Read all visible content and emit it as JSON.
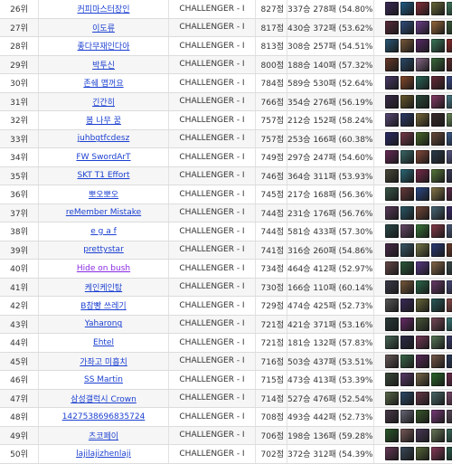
{
  "rankings": [
    {
      "rank": "26위",
      "name": "커피마스터장인",
      "tier": "CHALLENGER - I",
      "points": "827점",
      "record": "337승 278패 (54.80%)",
      "champs": [
        "#3b2a5a",
        "#1f5f8a",
        "#8a2f3a",
        "#6a6a3a",
        "#3f7a5f",
        "#c2a24a",
        "#2a3f7a",
        "#7a2a6a",
        "#3a6a8a",
        "#8a5a2a"
      ]
    },
    {
      "rank": "27위",
      "name": "이도류",
      "tier": "CHALLENGER - I",
      "points": "817점",
      "record": "430승 372패 (53.62%)",
      "champs": [
        "#5a2a3a",
        "#2f4f7f",
        "#6f3f8f",
        "#9a6a3a",
        "#3a5a3a",
        "#2a2a5a",
        "#7a3a2a",
        "#4a7a9a",
        "#9a4a6a",
        "#3a3a3a"
      ]
    },
    {
      "rank": "28위",
      "name": "좋다무재인다아",
      "tier": "CHALLENGER - I",
      "points": "813점",
      "record": "308승 257패 (54.51%)",
      "champs": [
        "#2a5a7a",
        "#7a5a3a",
        "#5a2a6a",
        "#3a7a5a",
        "#8a2a2a",
        "#4a4a8a",
        "#9a7a4a",
        "#2a3a5a",
        "#6a2a4a",
        "#5a6a2a"
      ]
    },
    {
      "rank": "29위",
      "name": "박투신",
      "tier": "CHALLENGER - I",
      "points": "800점",
      "record": "188승 140패 (57.32%)",
      "champs": [
        "#6a3a2a",
        "#2a4a6a",
        "#8a6a8a",
        "#3a6a3a",
        "#5a2a2a",
        "#2a6a8a",
        "#7a7a3a",
        "#4a2a6a",
        "#3a5a7a",
        "#8a3a5a"
      ]
    },
    {
      "rank": "30위",
      "name": "존쉐 맵꺼요",
      "tier": "CHALLENGER - I",
      "points": "784점",
      "record": "589승 530패 (52.64%)",
      "champs": [
        "#4a3a6a",
        "#8a4a2a",
        "#2a6a5a",
        "#6a2a3a",
        "#3a4a8a",
        "#9a8a5a",
        "#5a3a2a",
        "#2a5a4a",
        "#7a4a7a",
        "#4a6a9a"
      ]
    },
    {
      "rank": "31위",
      "name": "긴간히",
      "tier": "CHALLENGER - I",
      "points": "766점",
      "record": "354승 276패 (56.19%)",
      "champs": [
        "#3a2a4a",
        "#6a5a2a",
        "#2a4a3a",
        "#8a3a6a",
        "#4a7a8a",
        "#7a2a2a",
        "#3a3a7a",
        "#9a6a5a",
        "#2a6a3a",
        "#6a4a8a"
      ]
    },
    {
      "rank": "32위",
      "name": "봄 나무 꿈",
      "tier": "CHALLENGER - I",
      "points": "757점",
      "record": "212승 152패 (58.24%)",
      "champs": [
        "#5a4a7a",
        "#2a3a6a",
        "#7a6a3a",
        "#3a2a2a",
        "#6a8a5a",
        "#4a2a5a",
        "#8a5a4a",
        "#2a7a7a",
        "#5a3a4a",
        "#9a3a3a"
      ]
    },
    {
      "rank": "33위",
      "name": "juhbgtfcdesz",
      "tier": "CHALLENGER - I",
      "points": "757점",
      "record": "253승 166패 (60.38%)",
      "champs": [
        "#2a2a6a",
        "#7a3a4a",
        "#4a6a2a",
        "#6a4a3a",
        "#3a5a8a",
        "#8a7a6a",
        "#5a2a7a",
        "#2a4a5a",
        "#7a5a2a",
        "#3a7a4a"
      ]
    },
    {
      "rank": "34위",
      "name": "FW SwordArT",
      "tier": "CHALLENGER - I",
      "points": "749점",
      "record": "297승 247패 (54.60%)",
      "champs": [
        "#6a2a5a",
        "#3a6a6a",
        "#8a4a3a",
        "#2a3a4a",
        "#5a5a8a",
        "#7a6a2a",
        "#4a3a3a",
        "#3a8a6a",
        "#6a3a7a",
        "#2a5a2a"
      ]
    },
    {
      "rank": "35위",
      "name": "SKT T1 Effort",
      "tier": "CHALLENGER - I",
      "points": "746점",
      "record": "364승 311패 (53.93%)",
      "champs": [
        "#4a4a3a",
        "#2a6a7a",
        "#7a2a4a",
        "#5a7a3a",
        "#3a3a5a",
        "#8a6a3a",
        "#2a2a3a",
        "#6a5a7a",
        "#4a8a5a",
        "#7a4a2a"
      ]
    },
    {
      "rank": "36위",
      "name": "뽀오뽀오",
      "tier": "CHALLENGER - I",
      "points": "745점",
      "record": "217승 168패 (56.36%)",
      "champs": [
        "#3a5a4a",
        "#6a3a3a",
        "#2a4a8a",
        "#8a7a4a",
        "#5a2a4a",
        "#3a6a2a",
        "#7a5a6a",
        "#4a3a7a",
        "#2a7a5a",
        "#6a6a4a"
      ]
    },
    {
      "rank": "37위",
      "name": "reMember Mistake",
      "tier": "CHALLENGER - I",
      "points": "744점",
      "record": "231승 176패 (56.76%)",
      "champs": [
        "#5a3a5a",
        "#2a5a6a",
        "#7a4a3a",
        "#4a6a7a",
        "#3a2a6a",
        "#8a5a5a",
        "#2a3a2a",
        "#6a7a4a",
        "#4a4a6a",
        "#7a3a3a"
      ]
    },
    {
      "rank": "38위",
      "name": "e g a f",
      "tier": "CHALLENGER - I",
      "points": "744점",
      "record": "581승 433패 (57.30%)",
      "champs": [
        "#2a4a4a",
        "#6a4a6a",
        "#3a7a3a",
        "#8a3a4a",
        "#4a5a7a",
        "#7a6a5a",
        "#5a4a2a",
        "#2a6a6a",
        "#6a2a2a",
        "#3a4a6a"
      ]
    },
    {
      "rank": "39위",
      "name": "prettystar",
      "tier": "CHALLENGER - I",
      "points": "741점",
      "record": "316승 260패 (54.86%)",
      "champs": [
        "#4a2a4a",
        "#3a5a6a",
        "#7a7a4a",
        "#2a3a7a",
        "#6a3a2a",
        "#5a6a5a",
        "#8a4a6a",
        "#3a2a3a",
        "#4a7a6a",
        "#6a5a3a"
      ]
    },
    {
      "rank": "40위",
      "name": "Hide on bush",
      "tier": "CHALLENGER - I",
      "points": "734점",
      "record": "464승 412패 (52.97%)",
      "visited": true,
      "champs": [
        "#6a4a4a",
        "#2a5a3a",
        "#5a3a8a",
        "#8a6a4a",
        "#3a4a4a",
        "#7a2a5a",
        "#4a6a4a",
        "#2a2a7a",
        "#7a7a5a",
        "#5a2a3a"
      ]
    },
    {
      "rank": "41위",
      "name": "케인케인탑",
      "tier": "CHALLENGER - I",
      "points": "730점",
      "record": "166승 110패 (60.14%)",
      "champs": [
        "#3a3a4a",
        "#7a5a3a",
        "#2a6a4a",
        "#6a3a6a",
        "#4a4a7a",
        "#8a7a3a",
        "#5a5a3a",
        "#3a6a7a",
        "#7a3a6a",
        "#2a4a3a"
      ]
    },
    {
      "rank": "42위",
      "name": "B참빵 쓰레기",
      "tier": "CHALLENGER - I",
      "points": "729점",
      "record": "474승 425패 (52.73%)",
      "champs": [
        "#5a5a5a",
        "#3a2a5a",
        "#6a6a3a",
        "#2a5a5a",
        "#8a4a4a",
        "#4a3a6a",
        "#7a6a7a",
        "#3a5a3a",
        "#5a4a4a",
        "#6a7a6a"
      ]
    },
    {
      "rank": "43위",
      "name": "Yaharong",
      "tier": "CHALLENGER - I",
      "points": "721점",
      "record": "421승 371패 (53.16%)",
      "champs": [
        "#2a3a3a",
        "#6a2a6a",
        "#4a5a3a",
        "#7a4a5a",
        "#3a7a7a",
        "#5a3a3a",
        "#8a5a7a",
        "#2a4a7a",
        "#6a6a6a",
        "#4a2a3a"
      ]
    },
    {
      "rank": "44위",
      "name": "Ehtel",
      "tier": "CHALLENGER - I",
      "points": "721점",
      "record": "181승 132패 (57.83%)",
      "champs": [
        "#4a6a5a",
        "#2a2a4a",
        "#7a3a5a",
        "#5a7a5a",
        "#3a3a6a",
        "#6a4a2a",
        "#8a6a6a",
        "#2a5a7a",
        "#5a6a6a",
        "#3a4a2a"
      ]
    },
    {
      "rank": "45위",
      "name": "가좌고 미흡치",
      "tier": "CHALLENGER - I",
      "points": "716점",
      "record": "503승 437패 (53.51%)",
      "champs": [
        "#6a5a5a",
        "#3a6a4a",
        "#5a2a5a",
        "#7a5a4a",
        "#2a3a5a",
        "#4a7a4a",
        "#8a3a3a",
        "#3a2a7a",
        "#6a6a5a",
        "#4a5a5a"
      ]
    },
    {
      "rank": "46위",
      "name": "SS Martin",
      "tier": "CHALLENGER - I",
      "points": "715점",
      "record": "473승 413패 (53.39%)",
      "champs": [
        "#3a4a3a",
        "#5a3a6a",
        "#7a6a4a",
        "#2a6a2a",
        "#6a2a4a",
        "#4a4a5a",
        "#8a7a5a",
        "#3a5a5a",
        "#5a5a7a",
        "#7a2a3a"
      ]
    },
    {
      "rank": "47위",
      "name": "삼성갤럭시 Crown",
      "tier": "CHALLENGER - I",
      "points": "714점",
      "record": "527승 476패 (52.54%)",
      "champs": [
        "#5a6a4a",
        "#2a4a6a",
        "#6a3a4a",
        "#4a6a6a",
        "#7a4a6a",
        "#3a3a3a",
        "#8a6a5a",
        "#2a7a4a",
        "#6a5a6a",
        "#4a2a6a"
      ]
    },
    {
      "rank": "48위",
      "name": "1427538696835724",
      "tier": "CHALLENGER - I",
      "points": "708점",
      "record": "493승 442패 (52.73%)",
      "champs": [
        "#4a3a4a",
        "#6a6a7a",
        "#3a5a2a",
        "#7a3a7a",
        "#5a4a5a",
        "#2a6a3a",
        "#8a4a5a",
        "#3a7a5a",
        "#6a4a5a",
        "#5a3a2a"
      ]
    },
    {
      "rank": "49위",
      "name": "츠코페이",
      "tier": "CHALLENGER - I",
      "points": "706점",
      "record": "198승 136패 (59.28%)",
      "champs": [
        "#2a5a2a",
        "#7a5a5a",
        "#4a3a5a",
        "#6a7a5a",
        "#3a6a5a",
        "#5a2a2a",
        "#8a5a3a",
        "#2a3a6a",
        "#7a6a6a",
        "#4a5a4a"
      ]
    },
    {
      "rank": "50위",
      "name": "lajilajizhenlaji",
      "tier": "CHALLENGER - I",
      "points": "702점",
      "record": "372승 312패 (54.39%)",
      "champs": [
        "#6a3a5a",
        "#3a4a5a",
        "#5a6a3a",
        "#8a3a5a",
        "#2a5a4a",
        "#7a4a4a",
        "#4a6a3a",
        "#3a3a2a",
        "#6a2a7a",
        "#5a7a6a"
      ]
    }
  ]
}
